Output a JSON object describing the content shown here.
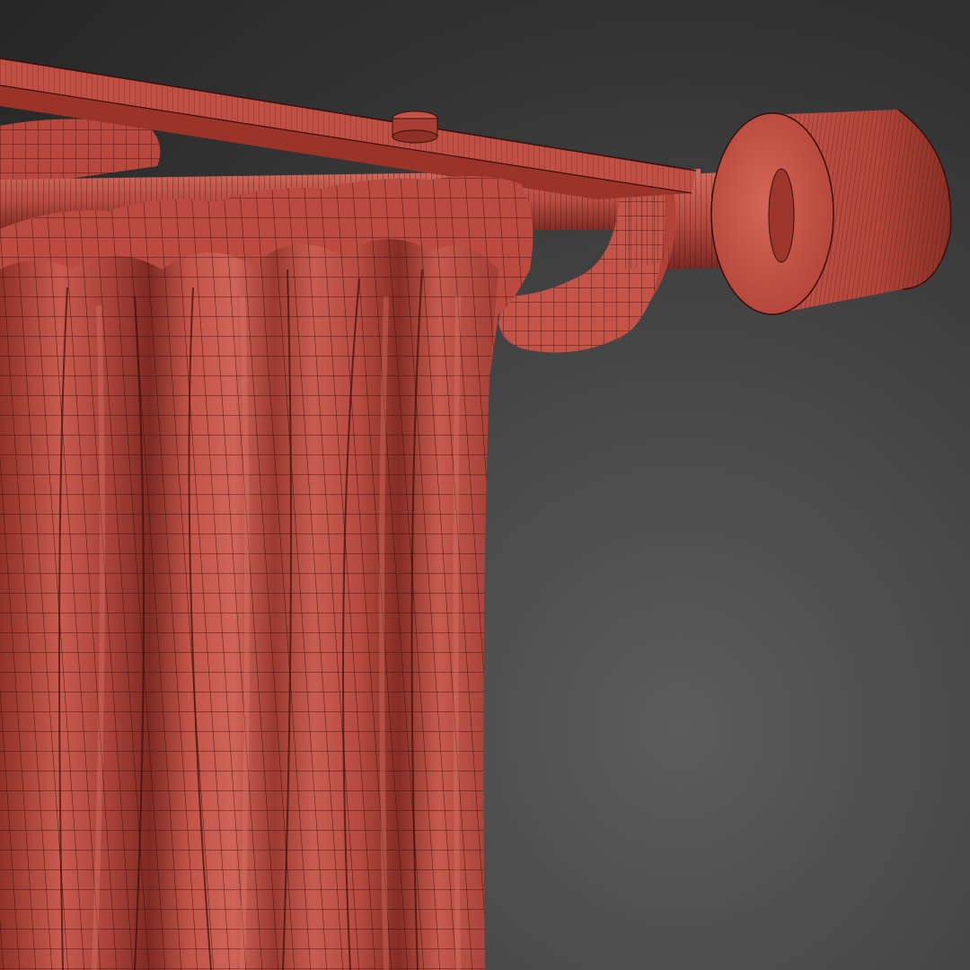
{
  "colors": {
    "background_light": "#5c5c5c",
    "background_dark": "#262626",
    "model_base": "#b84a3f",
    "model_shadow": "#7a2820",
    "model_highlight": "#d8665a",
    "wire": "#3a0e0a"
  },
  "scene": {
    "objects": [
      "curtain-rod",
      "rod-finial",
      "mounting-bracket",
      "rod-ring",
      "drapery-curtain"
    ],
    "render_style": "wireframe-over-shaded"
  }
}
